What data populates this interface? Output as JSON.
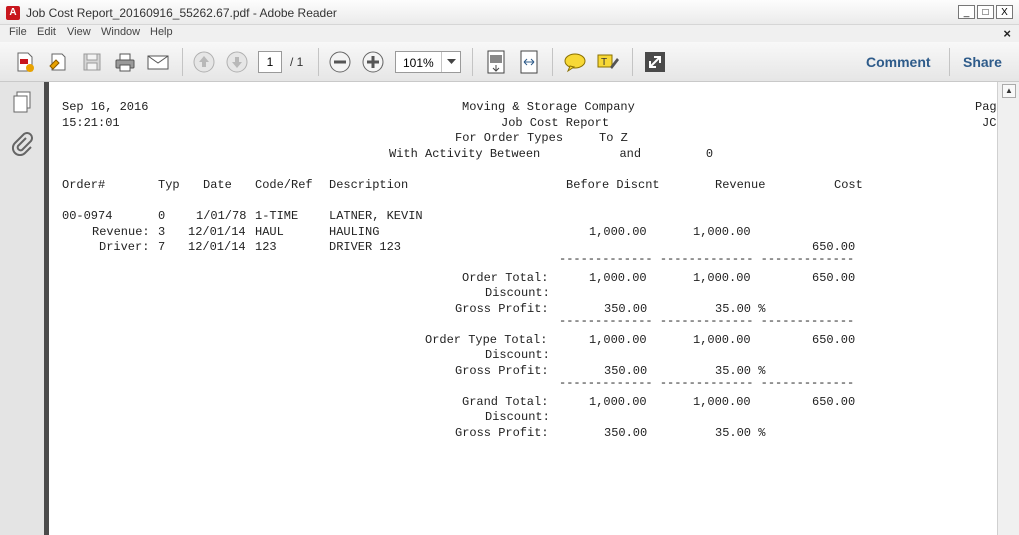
{
  "window": {
    "title": "Job Cost Report_20160916_55262.67.pdf - Adobe Reader",
    "min": "_",
    "max": "□",
    "close": "X"
  },
  "menu": {
    "items": [
      "File",
      "Edit",
      "View",
      "Window",
      "Help"
    ],
    "close": "×"
  },
  "toolbar": {
    "page_current": "1",
    "page_total": "/ 1",
    "zoom": "101%",
    "comment_label": "Comment",
    "share_label": "Share"
  },
  "report": {
    "header_left": [
      "Sep 16, 2016",
      "15:21:01"
    ],
    "header_center": [
      "Moving & Storage Company",
      "Job Cost Report",
      "For Order Types     To Z",
      "With Activity Between           and         0"
    ],
    "header_right": [
      "Pag",
      "JC"
    ],
    "columns": [
      "Order#",
      "Typ",
      "Date",
      "Code/Ref",
      "Description",
      "Before Discnt",
      "Revenue",
      "Cost"
    ],
    "order_row": {
      "order": "00-0974",
      "typ": "0",
      "date": "1/01/78",
      "code": "1-TIME",
      "desc": "LATNER, KEVIN"
    },
    "lines": [
      {
        "label": "Revenue:",
        "typ": "3",
        "date": "12/01/14",
        "code": "HAUL",
        "desc": "HAULING",
        "before": "1,000.00",
        "revenue": "1,000.00",
        "cost": ""
      },
      {
        "label": "Driver:",
        "typ": "7",
        "date": "12/01/14",
        "code": "123",
        "desc": "DRIVER 123",
        "before": "",
        "revenue": "",
        "cost": "650.00"
      }
    ],
    "rule": "------------- ------------- -------------",
    "totals": [
      {
        "label": "Order Total:",
        "before": "1,000.00",
        "revenue": "1,000.00",
        "cost": "650.00",
        "discount_label": "Discount:",
        "gp_label": "Gross Profit:",
        "gp_amount": "350.00",
        "gp_pct": "35.00 %"
      },
      {
        "label": "Order Type Total:",
        "before": "1,000.00",
        "revenue": "1,000.00",
        "cost": "650.00",
        "discount_label": "Discount:",
        "gp_label": "Gross Profit:",
        "gp_amount": "350.00",
        "gp_pct": "35.00 %"
      },
      {
        "label": "Grand Total:",
        "before": "1,000.00",
        "revenue": "1,000.00",
        "cost": "650.00",
        "discount_label": "Discount:",
        "gp_label": "Gross Profit:",
        "gp_amount": "350.00",
        "gp_pct": "35.00 %"
      }
    ]
  },
  "icons": [
    "create-pdf-icon",
    "sign-icon",
    "save-icon",
    "print-icon",
    "email-icon",
    "prev-page-icon",
    "next-page-icon",
    "zoom-out-icon",
    "zoom-in-icon",
    "fit-page-icon",
    "fit-width-icon",
    "comment-icon",
    "highlight-icon",
    "fullscreen-icon",
    "pages-icon",
    "attachment-icon"
  ]
}
